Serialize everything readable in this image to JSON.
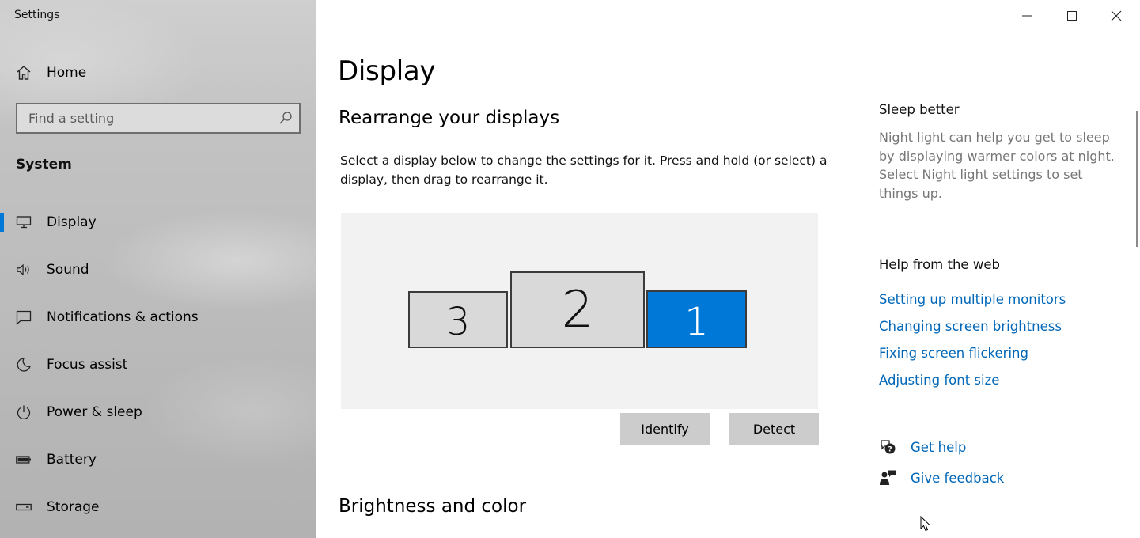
{
  "window": {
    "title": "Settings"
  },
  "sidebar": {
    "home_label": "Home",
    "search_placeholder": "Find a setting",
    "section_title": "System",
    "items": [
      {
        "label": "Display",
        "icon": "monitor-icon",
        "active": true
      },
      {
        "label": "Sound",
        "icon": "speaker-icon",
        "active": false
      },
      {
        "label": "Notifications & actions",
        "icon": "notification-icon",
        "active": false
      },
      {
        "label": "Focus assist",
        "icon": "moon-icon",
        "active": false
      },
      {
        "label": "Power & sleep",
        "icon": "power-icon",
        "active": false
      },
      {
        "label": "Battery",
        "icon": "battery-icon",
        "active": false
      },
      {
        "label": "Storage",
        "icon": "storage-icon",
        "active": false
      }
    ]
  },
  "main": {
    "title": "Display",
    "rearrange_heading": "Rearrange your displays",
    "rearrange_desc": "Select a display below to change the settings for it. Press and hold (or select) a display, then drag to rearrange it.",
    "monitors": [
      {
        "label": "3",
        "selected": false
      },
      {
        "label": "2",
        "selected": false
      },
      {
        "label": "1",
        "selected": true
      }
    ],
    "identify_label": "Identify",
    "detect_label": "Detect",
    "brightness_heading": "Brightness and color"
  },
  "right": {
    "sleep_title": "Sleep better",
    "sleep_body": "Night light can help you get to sleep by displaying warmer colors at night. Select Night light settings to set things up.",
    "help_title": "Help from the web",
    "links": [
      "Setting up multiple monitors",
      "Changing screen brightness",
      "Fixing screen flickering",
      "Adjusting font size"
    ],
    "get_help": "Get help",
    "give_feedback": "Give feedback"
  },
  "colors": {
    "accent": "#0078d7",
    "link": "#0067b8",
    "button": "#cccccc"
  }
}
